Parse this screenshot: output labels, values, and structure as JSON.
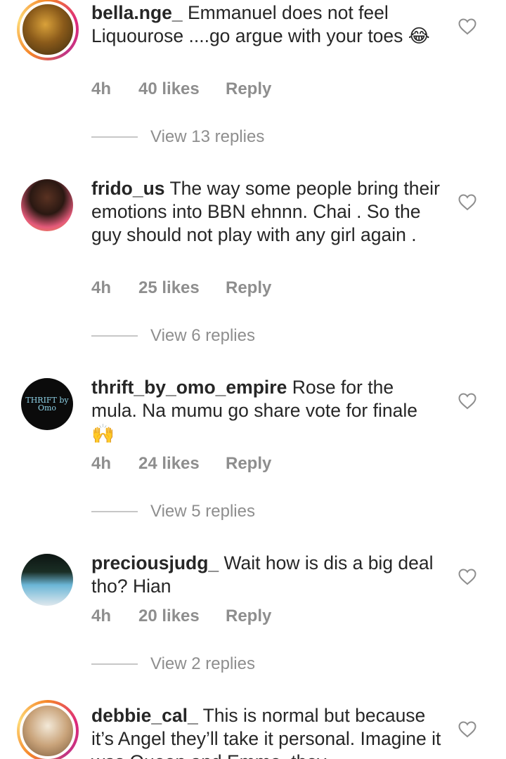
{
  "comments": [
    {
      "username": "bella.nge_",
      "text": "Emmanuel does not feel Liquourose ....go argue with your toes 😂",
      "time": "4h",
      "likes": "40 likes",
      "reply": "Reply",
      "view_replies": "View 13 replies",
      "avatar_icon": "user-avatar",
      "has_story": true
    },
    {
      "username": "frido_us",
      "text": "The way some people bring their emotions into BBN ehnnn. Chai . So the guy should not play with any girl again .",
      "time": "4h",
      "likes": "25 likes",
      "reply": "Reply",
      "view_replies": "View 6 replies",
      "avatar_icon": "user-avatar",
      "has_story": false
    },
    {
      "username": "thrift_by_omo_empire",
      "text": "Rose for the mula. Na mumu go share vote for finale 🙌",
      "time": "4h",
      "likes": "24 likes",
      "reply": "Reply",
      "view_replies": "View 5 replies",
      "avatar_icon": "brand-logo-avatar",
      "avatar_logo_text": "THRIFT by Omo",
      "has_story": false
    },
    {
      "username": "preciousjudg_",
      "text": "Wait how is dis a big deal tho? Hian",
      "time": "4h",
      "likes": "20 likes",
      "reply": "Reply",
      "view_replies": "View 2 replies",
      "avatar_icon": "user-avatar",
      "has_story": false
    },
    {
      "username": "debbie_cal_",
      "text": "This is normal but because it’s Angel they’ll take it personal. Imagine it was Queen and Emmo, they",
      "avatar_icon": "user-avatar",
      "has_story": true
    }
  ],
  "icons": {
    "like": "heart-outline-icon"
  },
  "colors": {
    "text": "#262626",
    "muted": "#8e8e8e",
    "divider": "#c7c7c7",
    "story_ring": [
      "#f58529",
      "#dd2a7b",
      "#c13584",
      "#feda77"
    ]
  }
}
